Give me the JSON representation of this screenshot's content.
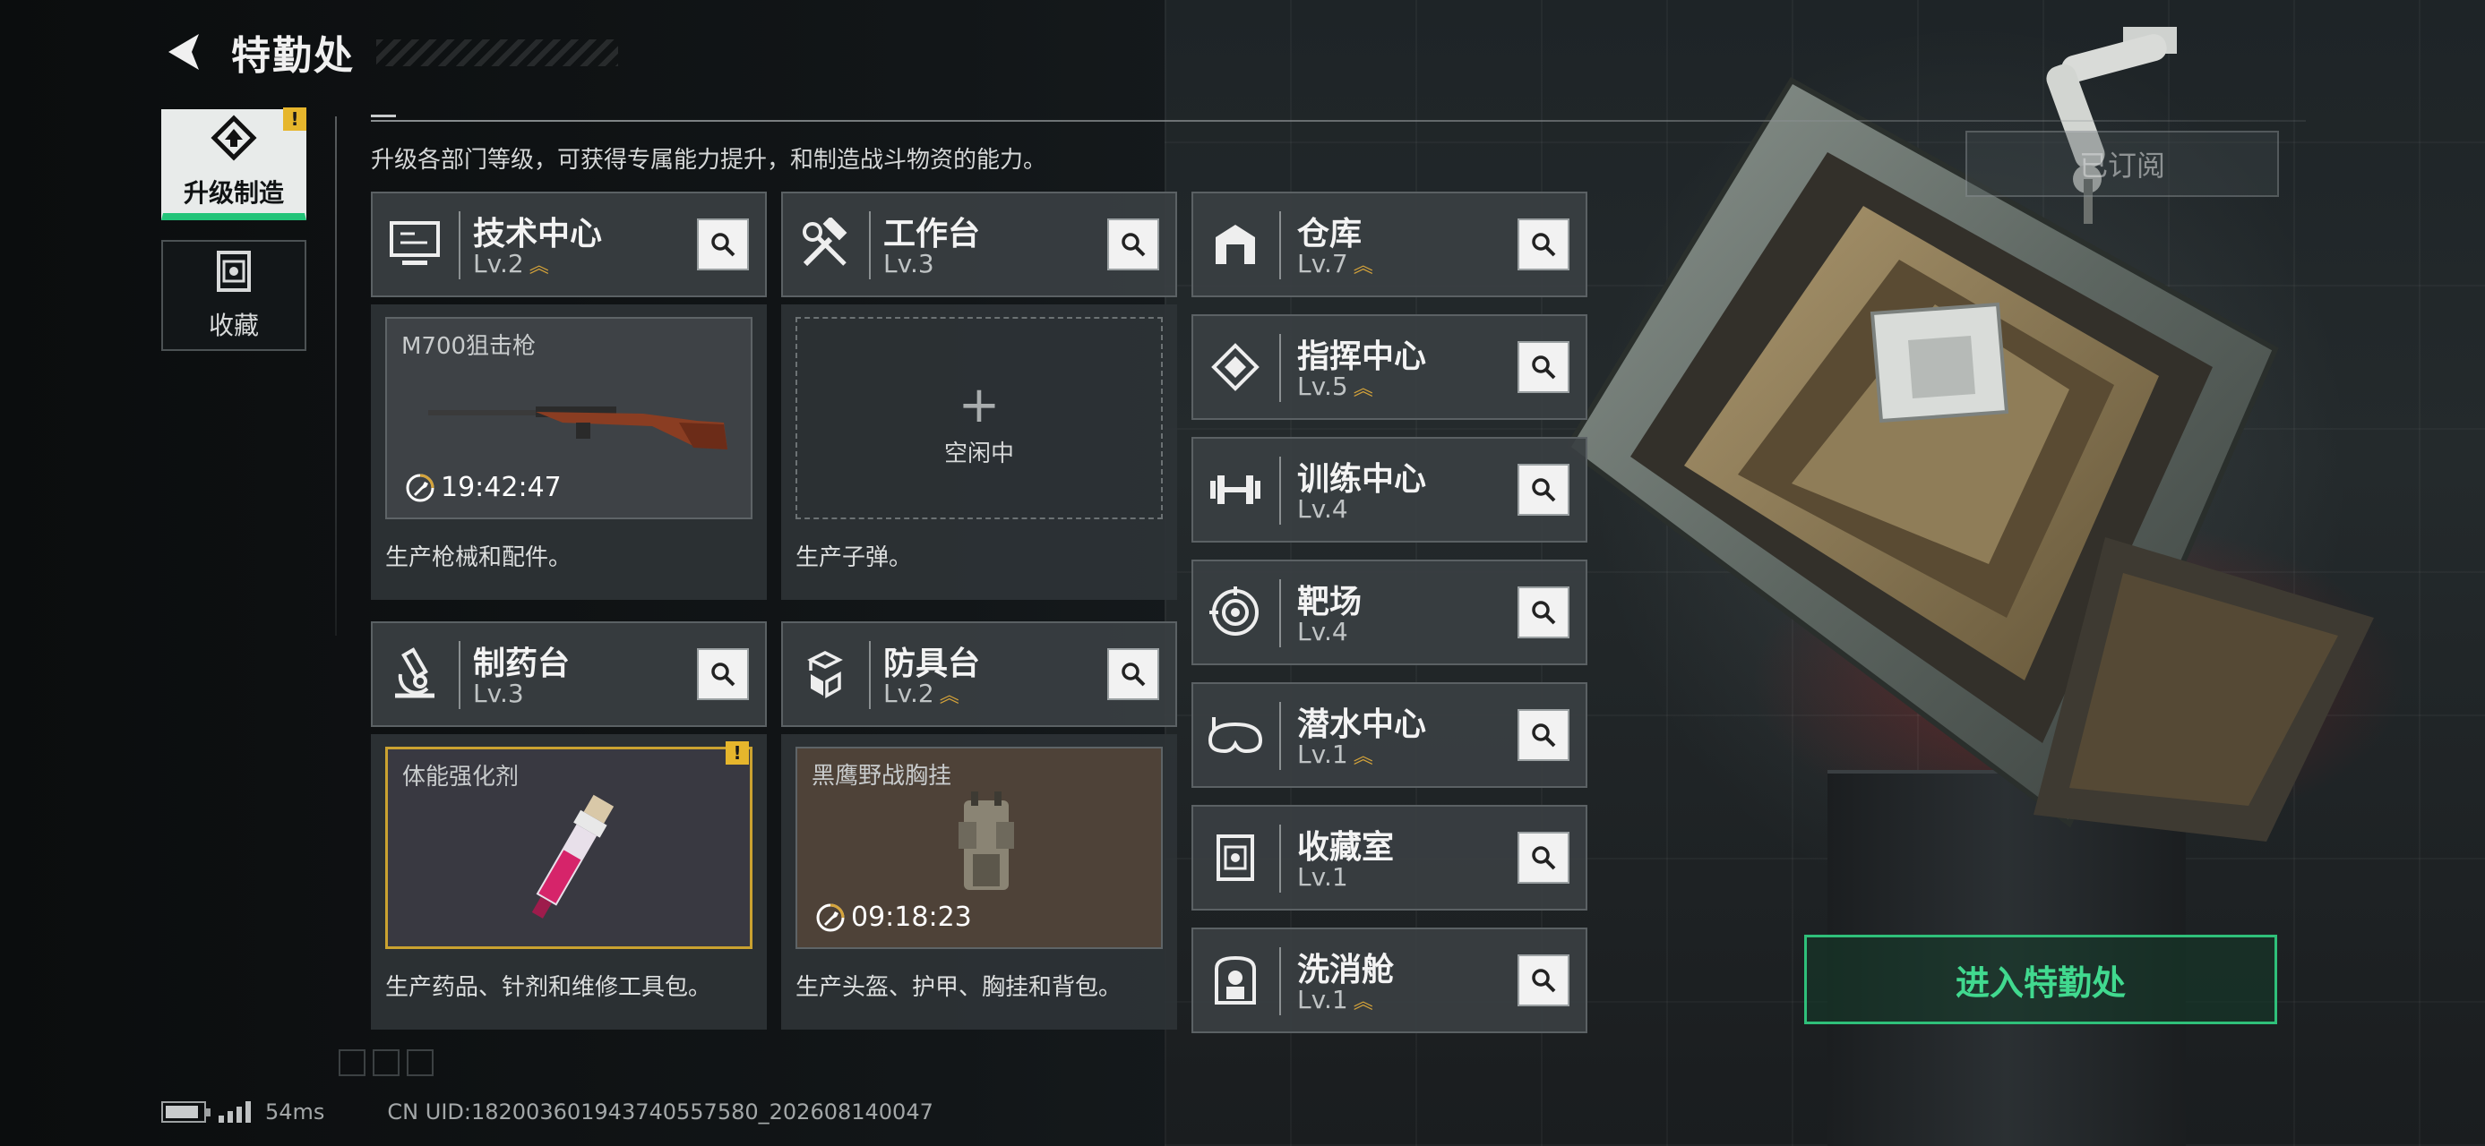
{
  "header": {
    "title": "特勤处",
    "description": "升级各部门等级，可获得专属能力提升，和制造战斗物资的能力。"
  },
  "side_tabs": [
    {
      "label": "升级制造",
      "icon": "upgrade-craft-icon",
      "active": true,
      "alert": "!"
    },
    {
      "label": "收藏",
      "icon": "collection-icon",
      "active": false
    }
  ],
  "departments": {
    "tech_center": {
      "name": "技术中心",
      "level": "Lv.2",
      "upgradeable": true,
      "icon": "computer-icon",
      "product": {
        "name": "M700狙击枪",
        "timer": "19:42:47"
      },
      "caption": "生产枪械和配件。"
    },
    "workbench": {
      "name": "工作台",
      "level": "Lv.3",
      "upgradeable": false,
      "icon": "tools-icon",
      "product": {
        "plus": "+",
        "status": "空闲中"
      },
      "caption": "生产子弹。"
    },
    "pharmacy": {
      "name": "制药台",
      "level": "Lv.3",
      "upgradeable": false,
      "icon": "microscope-icon",
      "product": {
        "name": "体能强化剂",
        "alert": "!"
      },
      "caption": "生产药品、针剂和维修工具包。"
    },
    "armor_bench": {
      "name": "防具台",
      "level": "Lv.2",
      "upgradeable": true,
      "icon": "armor-blocks-icon",
      "product": {
        "name": "黑鹰野战胸挂",
        "timer": "09:18:23"
      },
      "caption": "生产头盔、护甲、胸挂和背包。"
    }
  },
  "department_list": [
    {
      "name": "仓库",
      "level": "Lv.7",
      "upgradeable": true,
      "icon": "warehouse-icon"
    },
    {
      "name": "指挥中心",
      "level": "Lv.5",
      "upgradeable": true,
      "icon": "command-icon"
    },
    {
      "name": "训练中心",
      "level": "Lv.4",
      "upgradeable": false,
      "icon": "dumbbell-icon"
    },
    {
      "name": "靶场",
      "level": "Lv.4",
      "upgradeable": false,
      "icon": "target-icon"
    },
    {
      "name": "潜水中心",
      "level": "Lv.1",
      "upgradeable": true,
      "icon": "diving-mask-icon"
    },
    {
      "name": "收藏室",
      "level": "Lv.1",
      "upgradeable": false,
      "icon": "collection-room-icon"
    },
    {
      "name": "洗消舱",
      "level": "Lv.1",
      "upgradeable": true,
      "icon": "decontamination-icon"
    }
  ],
  "upgrade_marker": "︽",
  "actions": {
    "subscribe": "已订阅",
    "enter": "进入特勤处"
  },
  "status_bar": {
    "ping": "54ms",
    "uid": "CN UID:182003601943740557580_202608140047"
  },
  "colors": {
    "accent_green": "#2fc07a",
    "alert_yellow": "#e6b62c",
    "upgrade_gold": "#d6a43a"
  }
}
